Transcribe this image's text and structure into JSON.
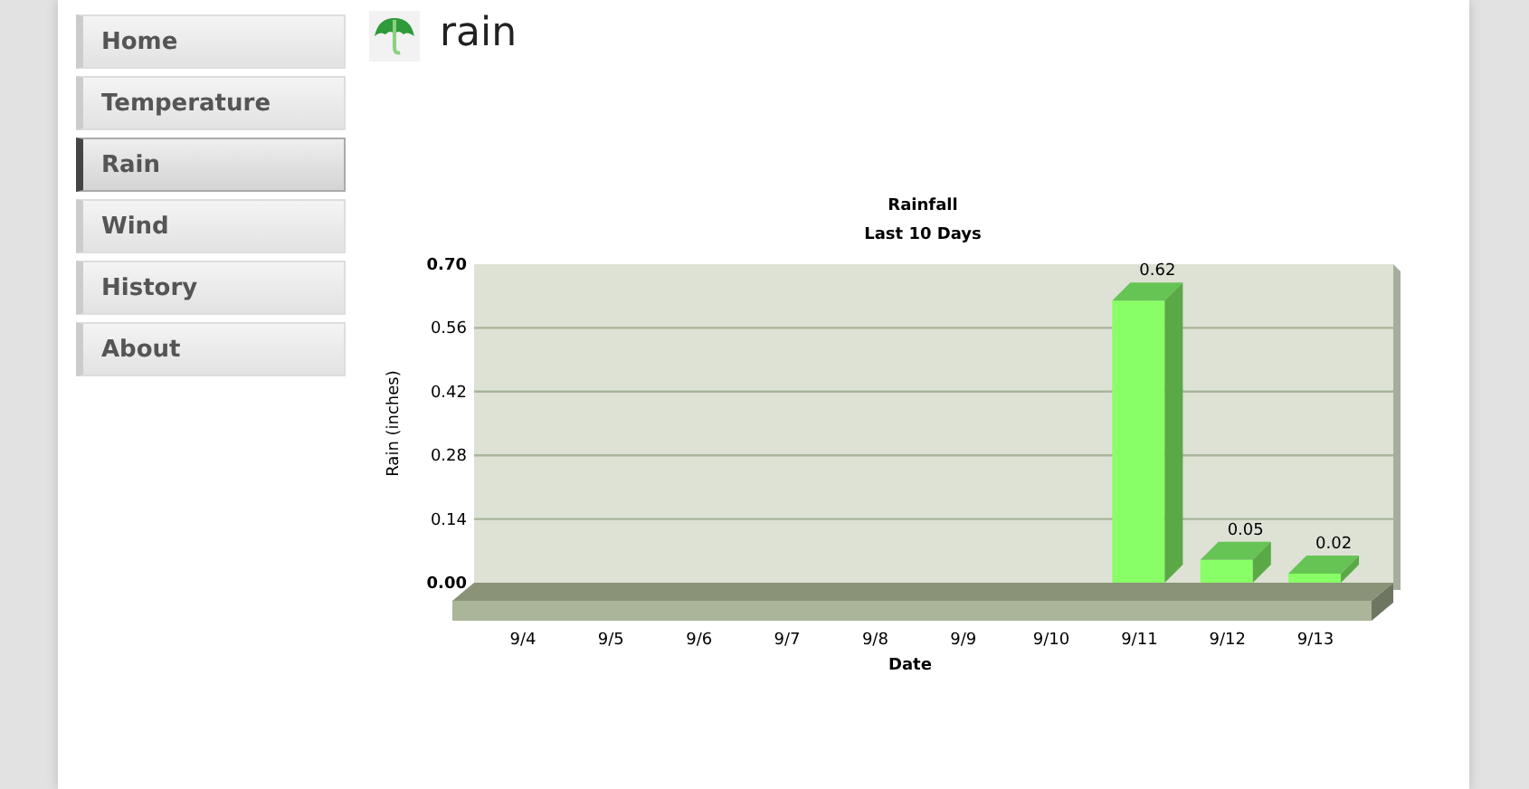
{
  "nav": [
    {
      "label": "Home",
      "selected": false
    },
    {
      "label": "Temperature",
      "selected": false
    },
    {
      "label": "Rain",
      "selected": true
    },
    {
      "label": "Wind",
      "selected": false
    },
    {
      "label": "History",
      "selected": false
    },
    {
      "label": "About",
      "selected": false
    }
  ],
  "page_title": "rain",
  "chart_data": {
    "type": "bar",
    "title": "Rainfall",
    "subtitle": "Last 10 Days",
    "xlabel": "Date",
    "ylabel": "Rain (inches)",
    "categories": [
      "9/4",
      "9/5",
      "9/6",
      "9/7",
      "9/8",
      "9/9",
      "9/10",
      "9/11",
      "9/12",
      "9/13"
    ],
    "series": [
      {
        "color": "#88ff66",
        "values": [
          0,
          0,
          0,
          0,
          0,
          0,
          0,
          0.62,
          0.05,
          0.02
        ]
      }
    ],
    "grid": true,
    "ylim": [
      0,
      0.7
    ],
    "yticks": [
      {
        "value": 0,
        "label": "0.00"
      },
      {
        "value": 0.14,
        "label": "0.14"
      },
      {
        "value": 0.28,
        "label": "0.28"
      },
      {
        "value": 0.42,
        "label": "0.42"
      },
      {
        "value": 0.56,
        "label": "0.56"
      },
      {
        "value": 0.7,
        "label": "0.70"
      }
    ],
    "value_labels": [
      null,
      null,
      null,
      null,
      null,
      null,
      null,
      "0.62",
      "0.05",
      "0.02"
    ]
  }
}
